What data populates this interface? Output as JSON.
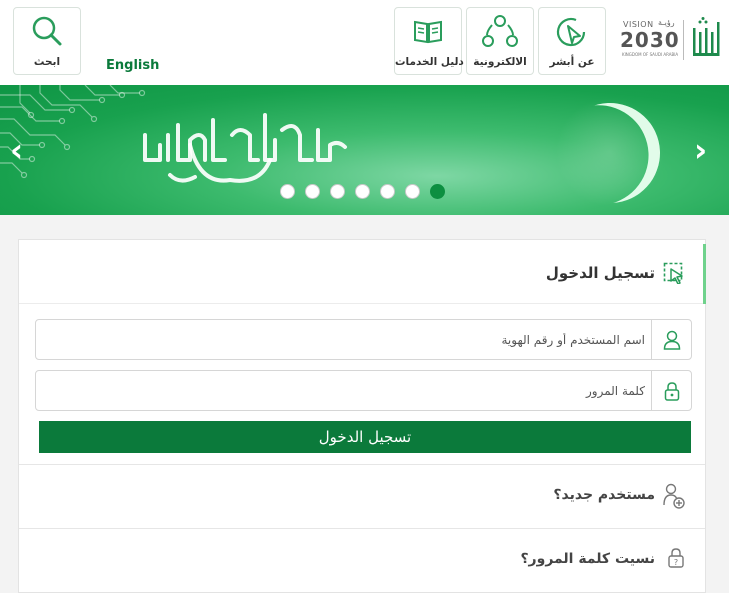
{
  "header": {
    "search_label": "ابحث",
    "english_label": "English",
    "tiles": [
      {
        "label": "دليل الخدمات",
        "icon": "book-icon"
      },
      {
        "label": "الالكترونية",
        "icon": "share-network-icon"
      },
      {
        "label": "عن أبشر",
        "icon": "cursor-circle-icon"
      }
    ],
    "vision": {
      "word": "VISION",
      "arabic": "رؤيـة",
      "year": "2030",
      "kingdom": "KINGDOM OF SAUDI ARABIA"
    }
  },
  "banner": {
    "slides_count": 7,
    "active_slide": 7,
    "prev_label": "‹",
    "next_label": "›"
  },
  "login": {
    "title": "تسجيل الدخول",
    "username_placeholder": "اسم المستخدم أو رقم الهوية",
    "password_placeholder": "كلمة المرور",
    "submit_label": "تسجيل الدخول",
    "new_user_label": "مستخدم جديد؟",
    "forgot_password_label": "نسيت كلمة المرور؟"
  },
  "colors": {
    "brand_green": "#0b7a3b",
    "banner_green": "#18a14e",
    "accent_light_green": "#6fd28c"
  }
}
